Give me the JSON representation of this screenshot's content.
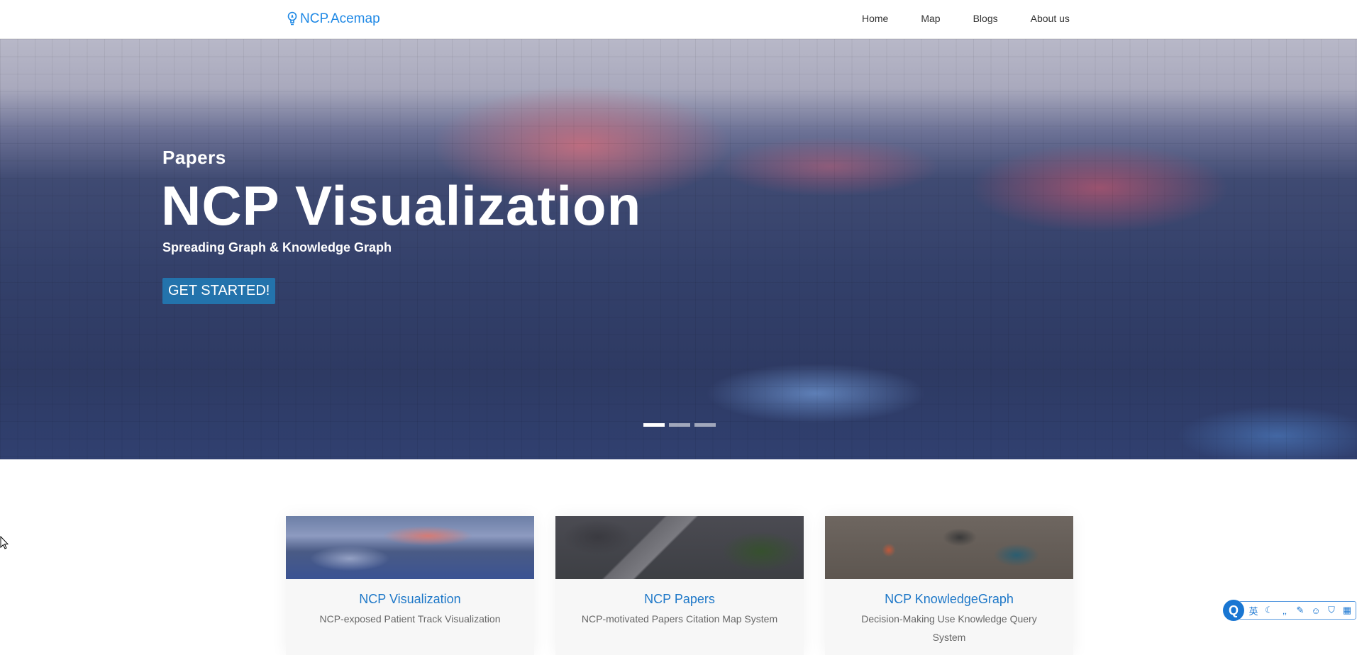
{
  "nav": {
    "brand": "NCP.Acemap",
    "links": [
      "Home",
      "Map",
      "Blogs",
      "About us"
    ]
  },
  "hero": {
    "eyebrow": "Papers",
    "title": "NCP Visualization",
    "subtitle": "Spreading Graph & Knowledge Graph",
    "cta": "GET STARTED!",
    "slides_total": 3,
    "slide_active": 1
  },
  "cards": [
    {
      "title": "NCP Visualization",
      "desc": "NCP-exposed Patient Track Visualization"
    },
    {
      "title": "NCP Papers",
      "desc": "NCP-motivated Papers Citation Map System"
    },
    {
      "title": "NCP KnowledgeGraph",
      "desc": "Decision-Making Use Knowledge Query System"
    }
  ],
  "ime": {
    "logo": "Q",
    "mode_label": "英",
    "icons": [
      "moon-icon",
      "quote-icon",
      "wrench-icon",
      "smiley-icon",
      "shirt-icon",
      "grid-icon"
    ]
  },
  "colors": {
    "brand": "#1e88e5",
    "cta_bg": "#2373ac",
    "card_title": "#1e78c8"
  }
}
